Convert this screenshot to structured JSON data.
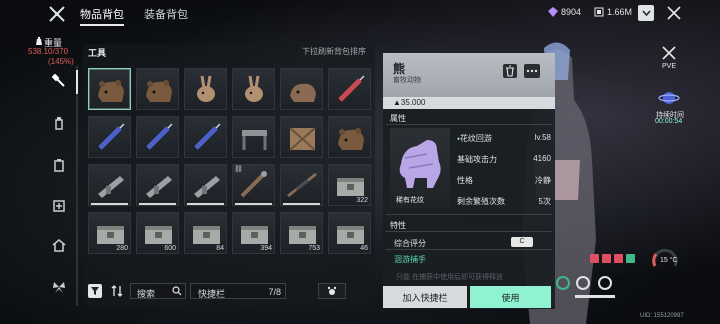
{
  "tabs": {
    "items_bag": "物品背包",
    "equipment_bag": "装备背包"
  },
  "currency": {
    "gems": "8904",
    "money": "1.66M"
  },
  "weight": {
    "label": "重量",
    "value": "538.10/370",
    "percent": "(145%)"
  },
  "section": {
    "title": "工具",
    "sort_hint": "下拉刷新背包排序"
  },
  "grid": {
    "rows": [
      [
        {
          "icon": "bear-head-icon",
          "selected": true
        },
        {
          "icon": "bear-head-icon"
        },
        {
          "icon": "rabbit-icon"
        },
        {
          "icon": "rabbit-icon"
        },
        {
          "icon": "boar-head-icon"
        },
        {
          "icon": "syringe-red-icon"
        }
      ],
      [
        {
          "icon": "syringe-blue-icon"
        },
        {
          "icon": "syringe-blue-icon"
        },
        {
          "icon": "syringe-blue-icon"
        },
        {
          "icon": "workbench-icon"
        },
        {
          "icon": "crate-icon"
        },
        {
          "icon": "bear-head-icon"
        }
      ],
      [
        {
          "icon": "weapon-icon",
          "bar": true
        },
        {
          "icon": "weapon-icon",
          "bar": true
        },
        {
          "icon": "weapon-icon",
          "bar": true
        },
        {
          "icon": "tool-icon",
          "bar": true,
          "lock": true
        },
        {
          "icon": "rifle-icon",
          "bar": true
        },
        {
          "icon": "ammo-box-icon",
          "count": "322"
        }
      ],
      [
        {
          "icon": "ammo-box-icon",
          "count": "280"
        },
        {
          "icon": "ammo-box-icon",
          "count": "600"
        },
        {
          "icon": "ammo-box-icon",
          "count": "84"
        },
        {
          "icon": "ammo-box-icon",
          "count": "394"
        },
        {
          "icon": "ammo-box-icon",
          "count": "753"
        },
        {
          "icon": "ammo-box-icon",
          "count": "46"
        }
      ]
    ]
  },
  "toolbar": {
    "search": "搜索",
    "quickbar": "快捷栏",
    "quickbar_count": "7/8"
  },
  "detail": {
    "name": "熊",
    "type": "畜牧动物",
    "weight": "35.000",
    "attr_title": "属性",
    "rarity": "稀有花纹",
    "stats": [
      {
        "key": "花纹回游",
        "value": "lv.58"
      },
      {
        "key": "基础攻击力",
        "value": "4160"
      },
      {
        "key": "性格",
        "value": "冷静"
      },
      {
        "key": "剩余繁殖次数",
        "value": "5次"
      }
    ],
    "feature_title": "特性",
    "score_label": "综合评分",
    "score_badge": "C",
    "skill": "洄游捕手",
    "faded": "只能 在捕获中使用后即可获得释放",
    "add_quickbar": "加入快捷栏",
    "use": "使用"
  },
  "side": {
    "pve": "PVE",
    "time_label": "持续时间",
    "time_value": "00:00:54"
  },
  "hud": {
    "temperature": "15 °C",
    "uid": "UID: 155120997"
  },
  "colors": {
    "accent": "#8ff2d0",
    "danger": "#e05b5b"
  }
}
